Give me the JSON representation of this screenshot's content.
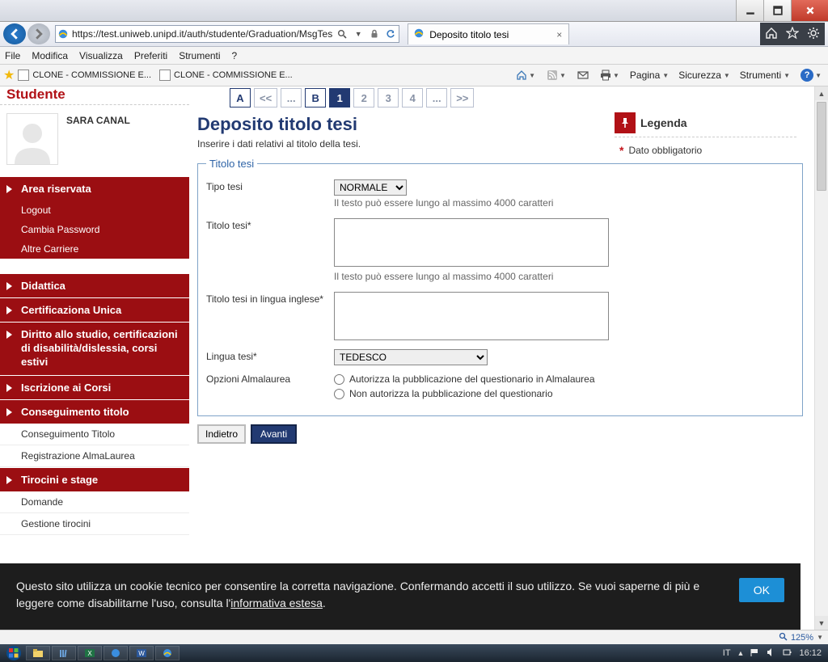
{
  "browser": {
    "url": "https://test.uniweb.unipd.it/auth/studente/Graduation/MsgTes",
    "tab_title": "Deposito titolo tesi",
    "menus": {
      "file": "File",
      "modifica": "Modifica",
      "visualizza": "Visualizza",
      "preferiti": "Preferiti",
      "strumenti": "Strumenti",
      "help": "?"
    },
    "fav1": "CLONE - COMMISSIONE E...",
    "fav2": "CLONE - COMMISSIONE E...",
    "cmd": {
      "pagina": "Pagina",
      "sicurezza": "Sicurezza",
      "strumenti": "Strumenti"
    }
  },
  "sidebar": {
    "heading": "Studente",
    "user_name": "SARA CANAL",
    "area_riservata": "Area riservata",
    "logout": "Logout",
    "cambia_pw": "Cambia Password",
    "altre_carriere": "Altre Carriere",
    "didattica": "Didattica",
    "cert_unica": "Certificaziona Unica",
    "diritto": "Diritto allo studio, certificazioni di disabilità/dislessia, corsi estivi",
    "iscrizione": "Iscrizione ai Corsi",
    "conseguimento": "Conseguimento titolo",
    "cons_titolo_sub": "Conseguimento Titolo",
    "reg_alma": "Registrazione AlmaLaurea",
    "tirocini": "Tirocini e stage",
    "domande": "Domande",
    "gestione_tir": "Gestione tirocini"
  },
  "wizard": {
    "a": "A",
    "prev": "<<",
    "dots": "...",
    "b": "B",
    "s1": "1",
    "s2": "2",
    "s3": "3",
    "s4": "4",
    "next": ">>"
  },
  "main": {
    "title": "Deposito titolo tesi",
    "subtitle": "Inserire i dati relativi al titolo della tesi.",
    "fieldset_legend": "Titolo tesi",
    "tipo_label": "Tipo tesi",
    "tipo_value": "NORMALE",
    "hint_4000": "Il testo può essere lungo al massimo 4000 caratteri",
    "titolo_label": "Titolo tesi*",
    "titolo_en_label": "Titolo tesi in lingua inglese*",
    "lingua_label": "Lingua tesi*",
    "lingua_value": "TEDESCO",
    "opzioni_label": "Opzioni Almalaurea",
    "radio_auth": "Autorizza la pubblicazione del questionario in Almalaurea",
    "radio_noauth": "Non autorizza la pubblicazione del questionario",
    "btn_back": "Indietro",
    "btn_fwd": "Avanti"
  },
  "legend": {
    "title": "Legenda",
    "mandatory": "Dato obbligatorio"
  },
  "cookie": {
    "text_a": "Questo sito utilizza un cookie tecnico per consentire la corretta navigazione. Confermando accetti il suo utilizzo. Se vuoi saperne di più e leggere come disabilitarne l'uso, consulta l'",
    "link": "informativa estesa",
    "text_b": ".",
    "ok": "OK"
  },
  "status": {
    "zoom": "125%"
  },
  "taskbar": {
    "lang": "IT",
    "clock": "16:12"
  }
}
